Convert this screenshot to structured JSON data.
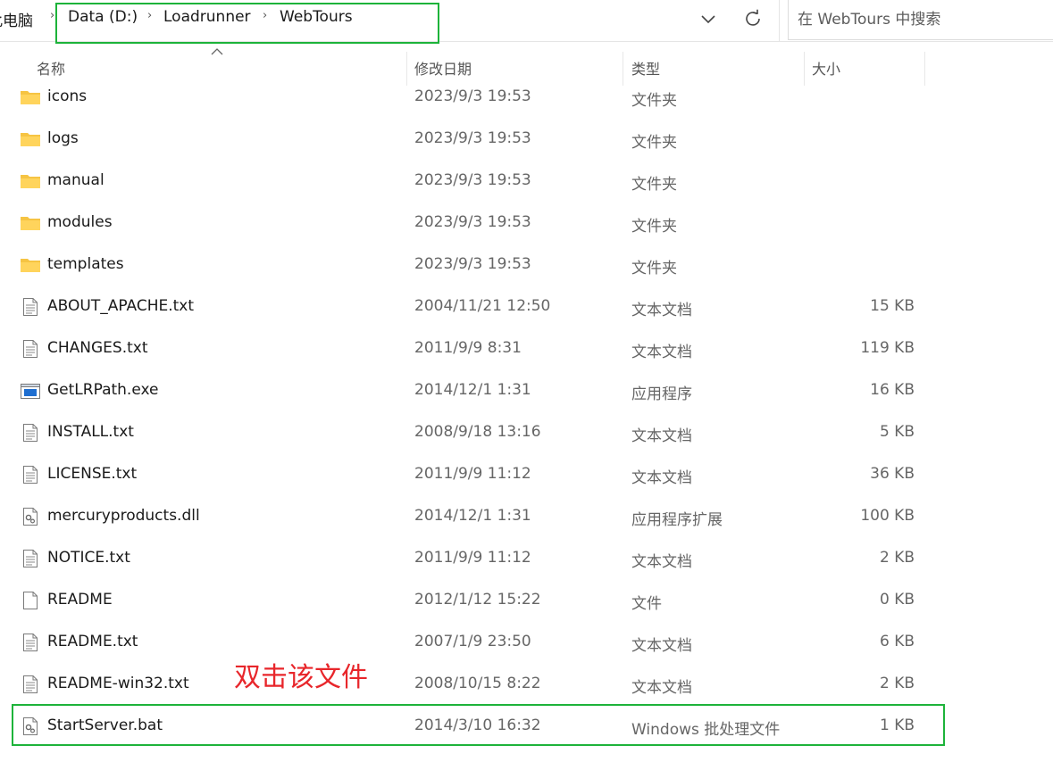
{
  "breadcrumb": {
    "root": "此电脑",
    "items": [
      "Data (D:)",
      "Loadrunner",
      "WebTours"
    ]
  },
  "search": {
    "placeholder": "在 WebTours 中搜索"
  },
  "columns": {
    "name": "名称",
    "date": "修改日期",
    "type": "类型",
    "size": "大小"
  },
  "files": [
    {
      "name": "icons",
      "date": "2023/9/3 19:53",
      "type": "文件夹",
      "size": "",
      "icon": "folder-icon"
    },
    {
      "name": "logs",
      "date": "2023/9/3 19:53",
      "type": "文件夹",
      "size": "",
      "icon": "folder-icon"
    },
    {
      "name": "manual",
      "date": "2023/9/3 19:53",
      "type": "文件夹",
      "size": "",
      "icon": "folder-icon"
    },
    {
      "name": "modules",
      "date": "2023/9/3 19:53",
      "type": "文件夹",
      "size": "",
      "icon": "folder-icon"
    },
    {
      "name": "templates",
      "date": "2023/9/3 19:53",
      "type": "文件夹",
      "size": "",
      "icon": "folder-icon"
    },
    {
      "name": "ABOUT_APACHE.txt",
      "date": "2004/11/21 12:50",
      "type": "文本文档",
      "size": "15 KB",
      "icon": "text-file-icon"
    },
    {
      "name": "CHANGES.txt",
      "date": "2011/9/9 8:31",
      "type": "文本文档",
      "size": "119 KB",
      "icon": "text-file-icon"
    },
    {
      "name": "GetLRPath.exe",
      "date": "2014/12/1 1:31",
      "type": "应用程序",
      "size": "16 KB",
      "icon": "exe-file-icon"
    },
    {
      "name": "INSTALL.txt",
      "date": "2008/9/18 13:16",
      "type": "文本文档",
      "size": "5 KB",
      "icon": "text-file-icon"
    },
    {
      "name": "LICENSE.txt",
      "date": "2011/9/9 11:12",
      "type": "文本文档",
      "size": "36 KB",
      "icon": "text-file-icon"
    },
    {
      "name": "mercuryproducts.dll",
      "date": "2014/12/1 1:31",
      "type": "应用程序扩展",
      "size": "100 KB",
      "icon": "dll-file-icon"
    },
    {
      "name": "NOTICE.txt",
      "date": "2011/9/9 11:12",
      "type": "文本文档",
      "size": "2 KB",
      "icon": "text-file-icon"
    },
    {
      "name": "README",
      "date": "2012/1/12 15:22",
      "type": "文件",
      "size": "0 KB",
      "icon": "blank-file-icon"
    },
    {
      "name": "README.txt",
      "date": "2007/1/9 23:50",
      "type": "文本文档",
      "size": "6 KB",
      "icon": "text-file-icon"
    },
    {
      "name": "README-win32.txt",
      "date": "2008/10/15 8:22",
      "type": "文本文档",
      "size": "2 KB",
      "icon": "text-file-icon"
    },
    {
      "name": "StartServer.bat",
      "date": "2014/3/10 16:32",
      "type": "Windows 批处理文件",
      "size": "1 KB",
      "icon": "batch-file-icon"
    }
  ],
  "annotation": "双击该文件",
  "colors": {
    "highlight": "#1db33a",
    "annotation": "#e8262b",
    "folder": "#f6c443",
    "exe_blue": "#1f6fd1"
  }
}
